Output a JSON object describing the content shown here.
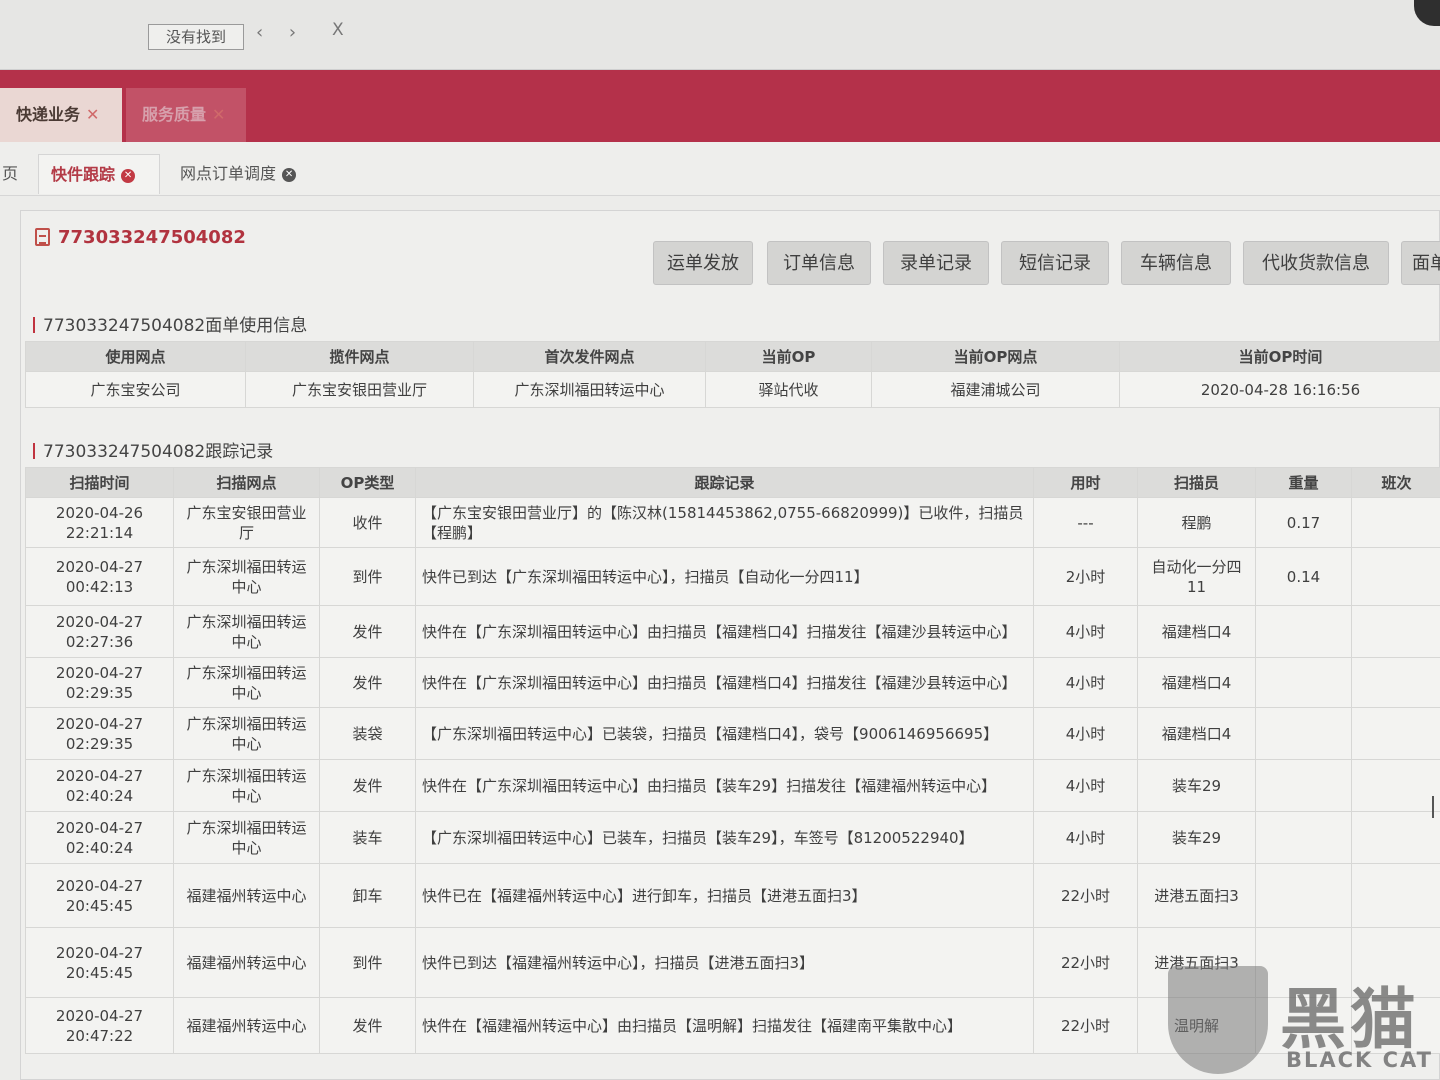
{
  "browser": {
    "status_text": "没有找到",
    "nav_arrows": "‹ ›",
    "close_glyph": "X"
  },
  "main_tabs": [
    {
      "label": "快递业务",
      "close": "✕"
    },
    {
      "label": "服务质量",
      "close": "✕"
    }
  ],
  "sub_tabs": {
    "home": "页",
    "items": [
      {
        "label": "快件跟踪",
        "close": "✕"
      },
      {
        "label": "网点订单调度",
        "close": "✕"
      }
    ]
  },
  "waybill": {
    "number": "773033247504082",
    "buttons": [
      "运单发放",
      "订单信息",
      "录单记录",
      "短信记录",
      "车辆信息",
      "代收货款信息",
      "面单"
    ]
  },
  "usage_section": {
    "title": "773033247504082面单使用信息",
    "headers": [
      "使用网点",
      "揽件网点",
      "首次发件网点",
      "当前OP",
      "当前OP网点",
      "当前OP时间"
    ],
    "row": [
      "广东宝安公司",
      "广东宝安银田营业厅",
      "广东深圳福田转运中心",
      "驿站代收",
      "福建浦城公司",
      "2020-04-28 16:16:56"
    ]
  },
  "tracking_section": {
    "title": "773033247504082跟踪记录",
    "headers": [
      "扫描时间",
      "扫描网点",
      "OP类型",
      "跟踪记录",
      "用时",
      "扫描员",
      "重量",
      "班次"
    ],
    "rows": [
      {
        "time": "2020-04-26 22:21:14",
        "site": "广东宝安银田营业厅",
        "op": "收件",
        "record": "【广东宝安银田营业厅】的【陈汉林(15814453862,0755-66820999)】已收件，扫描员【程鹏】",
        "duration": "---",
        "scanner": "程鹏",
        "weight": "0.17",
        "shift": ""
      },
      {
        "time": "2020-04-27 00:42:13",
        "site": "广东深圳福田转运中心",
        "op": "到件",
        "record": "快件已到达【广东深圳福田转运中心】，扫描员【自动化一分四11】",
        "duration": "2小时",
        "scanner": "自动化一分四11",
        "weight": "0.14",
        "shift": ""
      },
      {
        "time": "2020-04-27 02:27:36",
        "site": "广东深圳福田转运中心",
        "op": "发件",
        "record": "快件在【广东深圳福田转运中心】由扫描员【福建档口4】扫描发往【福建沙县转运中心】",
        "duration": "4小时",
        "scanner": "福建档口4",
        "weight": "",
        "shift": ""
      },
      {
        "time": "2020-04-27 02:29:35",
        "site": "广东深圳福田转运中心",
        "op": "发件",
        "record": "快件在【广东深圳福田转运中心】由扫描员【福建档口4】扫描发往【福建沙县转运中心】",
        "duration": "4小时",
        "scanner": "福建档口4",
        "weight": "",
        "shift": ""
      },
      {
        "time": "2020-04-27 02:29:35",
        "site": "广东深圳福田转运中心",
        "op": "装袋",
        "record": "【广东深圳福田转运中心】已装袋，扫描员【福建档口4】，袋号【9006146956695】",
        "duration": "4小时",
        "scanner": "福建档口4",
        "weight": "",
        "shift": ""
      },
      {
        "time": "2020-04-27 02:40:24",
        "site": "广东深圳福田转运中心",
        "op": "发件",
        "record": "快件在【广东深圳福田转运中心】由扫描员【装车29】扫描发往【福建福州转运中心】",
        "duration": "4小时",
        "scanner": "装车29",
        "weight": "",
        "shift": ""
      },
      {
        "time": "2020-04-27 02:40:24",
        "site": "广东深圳福田转运中心",
        "op": "装车",
        "record": "【广东深圳福田转运中心】已装车，扫描员【装车29】，车签号【81200522940】",
        "duration": "4小时",
        "scanner": "装车29",
        "weight": "",
        "shift": ""
      },
      {
        "time": "2020-04-27 20:45:45",
        "site": "福建福州转运中心",
        "op": "卸车",
        "record": "快件已在【福建福州转运中心】进行卸车，扫描员【进港五面扫3】",
        "duration": "22小时",
        "scanner": "进港五面扫3",
        "weight": "",
        "shift": ""
      },
      {
        "time": "2020-04-27 20:45:45",
        "site": "福建福州转运中心",
        "op": "到件",
        "record": "快件已到达【福建福州转运中心】，扫描员【进港五面扫3】",
        "duration": "22小时",
        "scanner": "进港五面扫3",
        "weight": "",
        "shift": ""
      },
      {
        "time": "2020-04-27 20:47:22",
        "site": "福建福州转运中心",
        "op": "发件",
        "record": "快件在【福建福州转运中心】由扫描员【温明解】扫描发往【福建南平集散中心】",
        "duration": "22小时",
        "scanner": "温明解",
        "weight": "",
        "shift": ""
      }
    ]
  },
  "watermark": {
    "text_cn": "黑猫",
    "text_en": "BLACK CAT"
  }
}
